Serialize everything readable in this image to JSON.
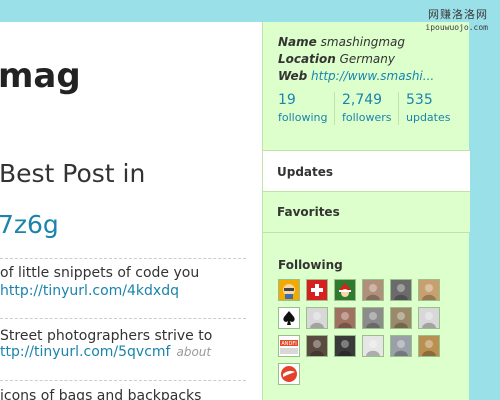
{
  "profile_title": "mag",
  "tweet": {
    "text": "Best Post in",
    "link": "7z6g"
  },
  "updates": [
    {
      "text": "of little snippets of code you",
      "link": "http://tinyurl.com/4kdxdq",
      "meta": ""
    },
    {
      "text": "Street photographers strive to",
      "link": "ttp://tinyurl.com/5qvcmf",
      "meta": "about"
    },
    {
      "text": "icons of bags and backpacks",
      "link": "",
      "meta": ""
    }
  ],
  "sidebar": {
    "name_label": "Name",
    "name_value": "smashingmag",
    "location_label": "Location",
    "location_value": "Germany",
    "web_label": "Web",
    "web_value": "http://www.smashi...",
    "stats": [
      {
        "count": "19",
        "label": "following"
      },
      {
        "count": "2,749",
        "label": "followers"
      },
      {
        "count": "535",
        "label": "updates"
      }
    ],
    "updates_label": "Updates",
    "favorites_label": "Favorites",
    "following_label": "Following",
    "following_avatars": [
      {
        "icon": "avatar-cartoon",
        "color": "#f2a900"
      },
      {
        "icon": "avatar-swiss-cross",
        "color": "#d62020"
      },
      {
        "icon": "avatar-santa",
        "color": "#2e7a2e"
      },
      {
        "icon": "avatar-photo",
        "color": "#b0907a"
      },
      {
        "icon": "avatar-photo",
        "color": "#6b6b6b"
      },
      {
        "icon": "avatar-photo",
        "color": "#c8a070"
      },
      {
        "icon": "avatar-spade",
        "color": "#111111"
      },
      {
        "icon": "avatar-photo",
        "color": "#d8d8d8"
      },
      {
        "icon": "avatar-photo",
        "color": "#a07060"
      },
      {
        "icon": "avatar-photo",
        "color": "#8c8c8c"
      },
      {
        "icon": "avatar-photo",
        "color": "#9a8a6a"
      },
      {
        "icon": "avatar-photo",
        "color": "#d8d8d8"
      },
      {
        "icon": "avatar-andfi-logo",
        "color": "#e34a2a",
        "text": "ANDFI"
      },
      {
        "icon": "avatar-photo",
        "color": "#5a4a40"
      },
      {
        "icon": "avatar-photo",
        "color": "#3a3a3a"
      },
      {
        "icon": "avatar-photo",
        "color": "#e6e6e6"
      },
      {
        "icon": "avatar-photo",
        "color": "#9aa0a8"
      },
      {
        "icon": "avatar-photo",
        "color": "#b89050"
      },
      {
        "icon": "avatar-red-logo",
        "color": "#e3412a"
      }
    ]
  },
  "watermark": {
    "line1": "网赚洛洛网",
    "line2": "ipouwuojo.com"
  }
}
